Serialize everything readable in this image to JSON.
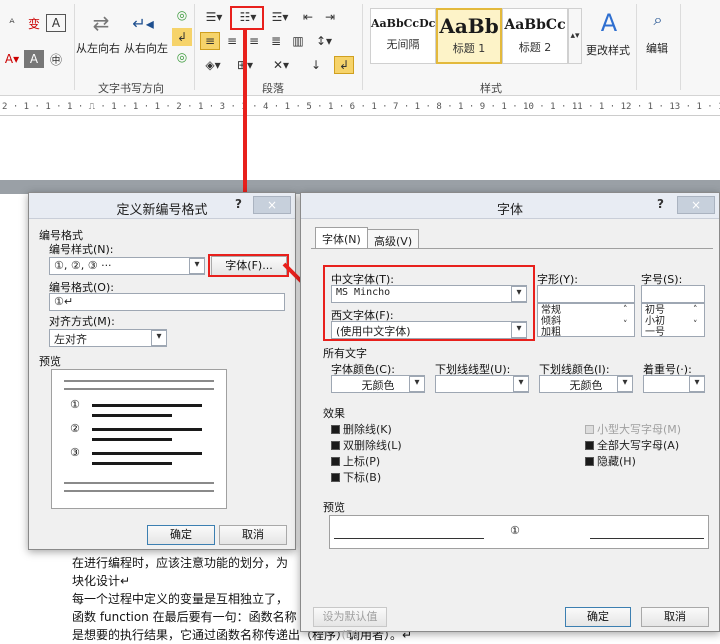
{
  "ribbon": {
    "text_direction": {
      "ltr_label": "从左向右",
      "rtl_label": "从右向左",
      "group_label": "文字书写方向"
    },
    "paragraph_group_label": "段落",
    "styles_group_label": "样式",
    "styles": [
      {
        "sample": "AaBbCcDc",
        "name": "无间隔"
      },
      {
        "sample": "AaBb",
        "name": "标题 1"
      },
      {
        "sample": "AaBbCc",
        "name": "标题 2"
      }
    ],
    "change_styles_label": "更改样式",
    "edit_label": "编辑"
  },
  "ruler": {
    "text": "2 · 1 · 1 · 1 · ⎍ · 1 · 1 · 1 · 2 · 1 · 3 · 1 · 4 · 1 · 5 · 1 · 6 · 1 · 7 · 1 · 8 · 1 · 9 · 1 · 10 · 1 · 11 · 1 · 12 · 1 · 13 · 1 · 14 · 1 △ 15 · 1 · 16 · 1 · 17 · 1"
  },
  "number_dialog": {
    "title": "定义新编号格式",
    "help": "?",
    "close": "×",
    "section_numbering": "编号格式",
    "style_label": "编号样式(N):",
    "style_value": "①, ②, ③ ···",
    "font_button": "字体(F)...",
    "format_label": "编号格式(O):",
    "format_value": "①↵",
    "align_label": "对齐方式(M):",
    "align_value": "左对齐",
    "preview_label": "预览",
    "preview_markers": [
      "①",
      "②",
      "③"
    ],
    "ok": "确定",
    "cancel": "取消"
  },
  "font_dialog": {
    "title": "字体",
    "help": "?",
    "close": "×",
    "tabs": [
      "字体(N)",
      "高级(V)"
    ],
    "chinese_font_label": "中文字体(T):",
    "chinese_font_value": "MS Mincho",
    "western_font_label": "西文字体(F):",
    "western_font_value": "(使用中文字体)",
    "style_label": "字形(Y):",
    "style_options": [
      "常规",
      "倾斜",
      "加粗"
    ],
    "size_label": "字号(S):",
    "size_options": [
      "初号",
      "小初",
      "一号"
    ],
    "all_text_label": "所有文字",
    "font_color_label": "字体颜色(C):",
    "font_color_value": "无颜色",
    "underline_type_label": "下划线线型(U):",
    "underline_color_label": "下划线颜色(I):",
    "underline_color_value": "无颜色",
    "emphasis_label": "着重号(·):",
    "effects_label": "效果",
    "effects_left": [
      "删除线(K)",
      "双删除线(L)",
      "上标(P)",
      "下标(B)"
    ],
    "effects_right": [
      "小型大写字母(M)",
      "全部大写字母(A)",
      "隐藏(H)"
    ],
    "preview_label": "预览",
    "preview_marker": "①",
    "set_default": "设为默认值(D)",
    "ok": "确定",
    "cancel": "取消"
  },
  "document": {
    "lines": [
      "在进行编程时，应该注意功能的划分，为",
      "块化设计↵",
      "每一个过程中定义的变量是互相独立了，",
      "函数 function 在最后要有一句：函数名称",
      "是想要的执行结果，它通过函数名称传递出（程序）调用者）。↵"
    ]
  },
  "colors": {
    "highlight": "#e8201c",
    "dialog_bg": "#f0f0f0"
  }
}
